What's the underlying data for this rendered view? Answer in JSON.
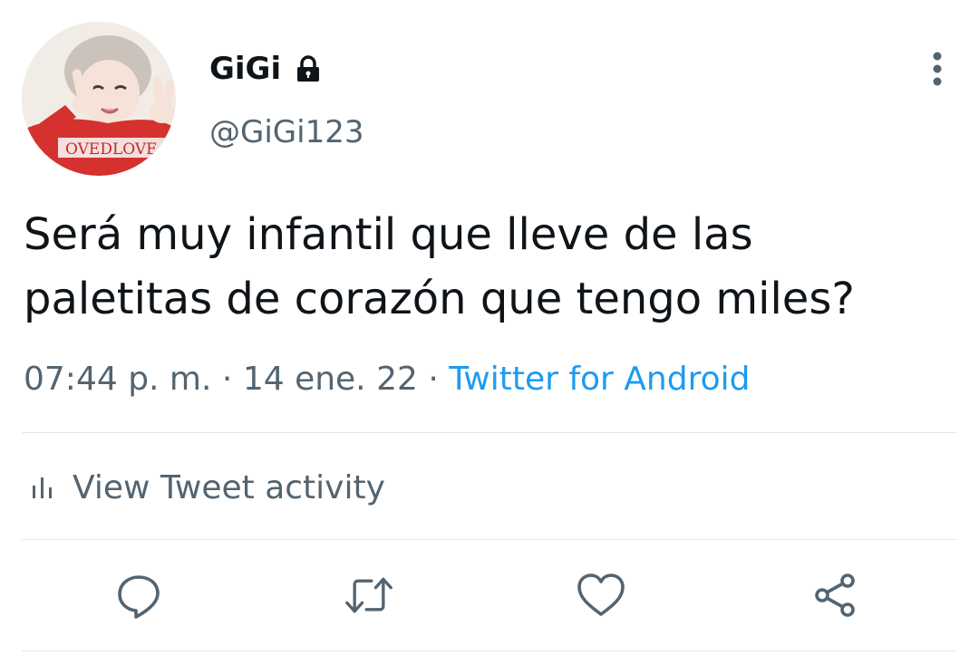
{
  "tweet": {
    "author": {
      "name": "GiGi",
      "handle": "@GiGi123",
      "avatar_icon": "profile-photo",
      "protected_icon": "lock-icon"
    },
    "text_lines": [
      "Será muy infantil que lleve de las",
      "paletitas de corazón que tengo miles?"
    ],
    "meta": {
      "time": "07:44 p. m.",
      "date": "14 ene. 22",
      "source": "Twitter for Android",
      "separator": "·"
    },
    "activity_label": "View Tweet activity",
    "actions": {
      "reply_icon": "reply-icon",
      "retweet_icon": "retweet-icon",
      "like_icon": "heart-icon",
      "share_icon": "share-icon",
      "more_icon": "more-vertical-icon"
    }
  },
  "colors": {
    "text_primary": "#0f1419",
    "text_secondary": "#536471",
    "link": "#1d9bf0",
    "divider": "#e4e8eb"
  }
}
